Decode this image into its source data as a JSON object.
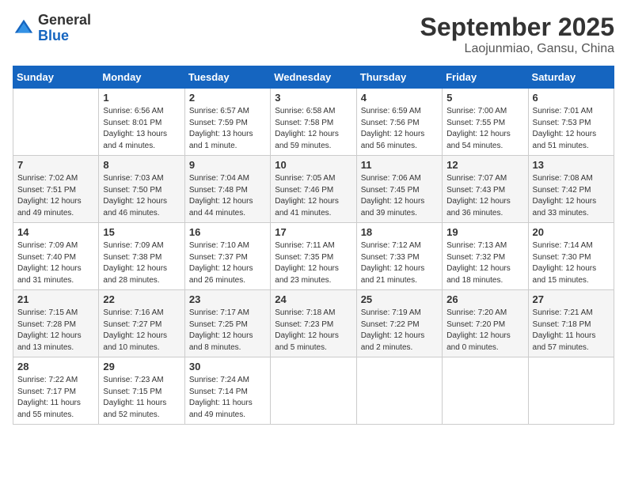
{
  "header": {
    "logo": {
      "general": "General",
      "blue": "Blue"
    },
    "title": "September 2025",
    "subtitle": "Laojunmiao, Gansu, China"
  },
  "calendar": {
    "days_of_week": [
      "Sunday",
      "Monday",
      "Tuesday",
      "Wednesday",
      "Thursday",
      "Friday",
      "Saturday"
    ],
    "weeks": [
      [
        {
          "day": "",
          "sunrise": "",
          "sunset": "",
          "daylight": ""
        },
        {
          "day": "1",
          "sunrise": "Sunrise: 6:56 AM",
          "sunset": "Sunset: 8:01 PM",
          "daylight": "Daylight: 13 hours and 4 minutes."
        },
        {
          "day": "2",
          "sunrise": "Sunrise: 6:57 AM",
          "sunset": "Sunset: 7:59 PM",
          "daylight": "Daylight: 13 hours and 1 minute."
        },
        {
          "day": "3",
          "sunrise": "Sunrise: 6:58 AM",
          "sunset": "Sunset: 7:58 PM",
          "daylight": "Daylight: 12 hours and 59 minutes."
        },
        {
          "day": "4",
          "sunrise": "Sunrise: 6:59 AM",
          "sunset": "Sunset: 7:56 PM",
          "daylight": "Daylight: 12 hours and 56 minutes."
        },
        {
          "day": "5",
          "sunrise": "Sunrise: 7:00 AM",
          "sunset": "Sunset: 7:55 PM",
          "daylight": "Daylight: 12 hours and 54 minutes."
        },
        {
          "day": "6",
          "sunrise": "Sunrise: 7:01 AM",
          "sunset": "Sunset: 7:53 PM",
          "daylight": "Daylight: 12 hours and 51 minutes."
        }
      ],
      [
        {
          "day": "7",
          "sunrise": "Sunrise: 7:02 AM",
          "sunset": "Sunset: 7:51 PM",
          "daylight": "Daylight: 12 hours and 49 minutes."
        },
        {
          "day": "8",
          "sunrise": "Sunrise: 7:03 AM",
          "sunset": "Sunset: 7:50 PM",
          "daylight": "Daylight: 12 hours and 46 minutes."
        },
        {
          "day": "9",
          "sunrise": "Sunrise: 7:04 AM",
          "sunset": "Sunset: 7:48 PM",
          "daylight": "Daylight: 12 hours and 44 minutes."
        },
        {
          "day": "10",
          "sunrise": "Sunrise: 7:05 AM",
          "sunset": "Sunset: 7:46 PM",
          "daylight": "Daylight: 12 hours and 41 minutes."
        },
        {
          "day": "11",
          "sunrise": "Sunrise: 7:06 AM",
          "sunset": "Sunset: 7:45 PM",
          "daylight": "Daylight: 12 hours and 39 minutes."
        },
        {
          "day": "12",
          "sunrise": "Sunrise: 7:07 AM",
          "sunset": "Sunset: 7:43 PM",
          "daylight": "Daylight: 12 hours and 36 minutes."
        },
        {
          "day": "13",
          "sunrise": "Sunrise: 7:08 AM",
          "sunset": "Sunset: 7:42 PM",
          "daylight": "Daylight: 12 hours and 33 minutes."
        }
      ],
      [
        {
          "day": "14",
          "sunrise": "Sunrise: 7:09 AM",
          "sunset": "Sunset: 7:40 PM",
          "daylight": "Daylight: 12 hours and 31 minutes."
        },
        {
          "day": "15",
          "sunrise": "Sunrise: 7:09 AM",
          "sunset": "Sunset: 7:38 PM",
          "daylight": "Daylight: 12 hours and 28 minutes."
        },
        {
          "day": "16",
          "sunrise": "Sunrise: 7:10 AM",
          "sunset": "Sunset: 7:37 PM",
          "daylight": "Daylight: 12 hours and 26 minutes."
        },
        {
          "day": "17",
          "sunrise": "Sunrise: 7:11 AM",
          "sunset": "Sunset: 7:35 PM",
          "daylight": "Daylight: 12 hours and 23 minutes."
        },
        {
          "day": "18",
          "sunrise": "Sunrise: 7:12 AM",
          "sunset": "Sunset: 7:33 PM",
          "daylight": "Daylight: 12 hours and 21 minutes."
        },
        {
          "day": "19",
          "sunrise": "Sunrise: 7:13 AM",
          "sunset": "Sunset: 7:32 PM",
          "daylight": "Daylight: 12 hours and 18 minutes."
        },
        {
          "day": "20",
          "sunrise": "Sunrise: 7:14 AM",
          "sunset": "Sunset: 7:30 PM",
          "daylight": "Daylight: 12 hours and 15 minutes."
        }
      ],
      [
        {
          "day": "21",
          "sunrise": "Sunrise: 7:15 AM",
          "sunset": "Sunset: 7:28 PM",
          "daylight": "Daylight: 12 hours and 13 minutes."
        },
        {
          "day": "22",
          "sunrise": "Sunrise: 7:16 AM",
          "sunset": "Sunset: 7:27 PM",
          "daylight": "Daylight: 12 hours and 10 minutes."
        },
        {
          "day": "23",
          "sunrise": "Sunrise: 7:17 AM",
          "sunset": "Sunset: 7:25 PM",
          "daylight": "Daylight: 12 hours and 8 minutes."
        },
        {
          "day": "24",
          "sunrise": "Sunrise: 7:18 AM",
          "sunset": "Sunset: 7:23 PM",
          "daylight": "Daylight: 12 hours and 5 minutes."
        },
        {
          "day": "25",
          "sunrise": "Sunrise: 7:19 AM",
          "sunset": "Sunset: 7:22 PM",
          "daylight": "Daylight: 12 hours and 2 minutes."
        },
        {
          "day": "26",
          "sunrise": "Sunrise: 7:20 AM",
          "sunset": "Sunset: 7:20 PM",
          "daylight": "Daylight: 12 hours and 0 minutes."
        },
        {
          "day": "27",
          "sunrise": "Sunrise: 7:21 AM",
          "sunset": "Sunset: 7:18 PM",
          "daylight": "Daylight: 11 hours and 57 minutes."
        }
      ],
      [
        {
          "day": "28",
          "sunrise": "Sunrise: 7:22 AM",
          "sunset": "Sunset: 7:17 PM",
          "daylight": "Daylight: 11 hours and 55 minutes."
        },
        {
          "day": "29",
          "sunrise": "Sunrise: 7:23 AM",
          "sunset": "Sunset: 7:15 PM",
          "daylight": "Daylight: 11 hours and 52 minutes."
        },
        {
          "day": "30",
          "sunrise": "Sunrise: 7:24 AM",
          "sunset": "Sunset: 7:14 PM",
          "daylight": "Daylight: 11 hours and 49 minutes."
        },
        {
          "day": "",
          "sunrise": "",
          "sunset": "",
          "daylight": ""
        },
        {
          "day": "",
          "sunrise": "",
          "sunset": "",
          "daylight": ""
        },
        {
          "day": "",
          "sunrise": "",
          "sunset": "",
          "daylight": ""
        },
        {
          "day": "",
          "sunrise": "",
          "sunset": "",
          "daylight": ""
        }
      ]
    ]
  }
}
